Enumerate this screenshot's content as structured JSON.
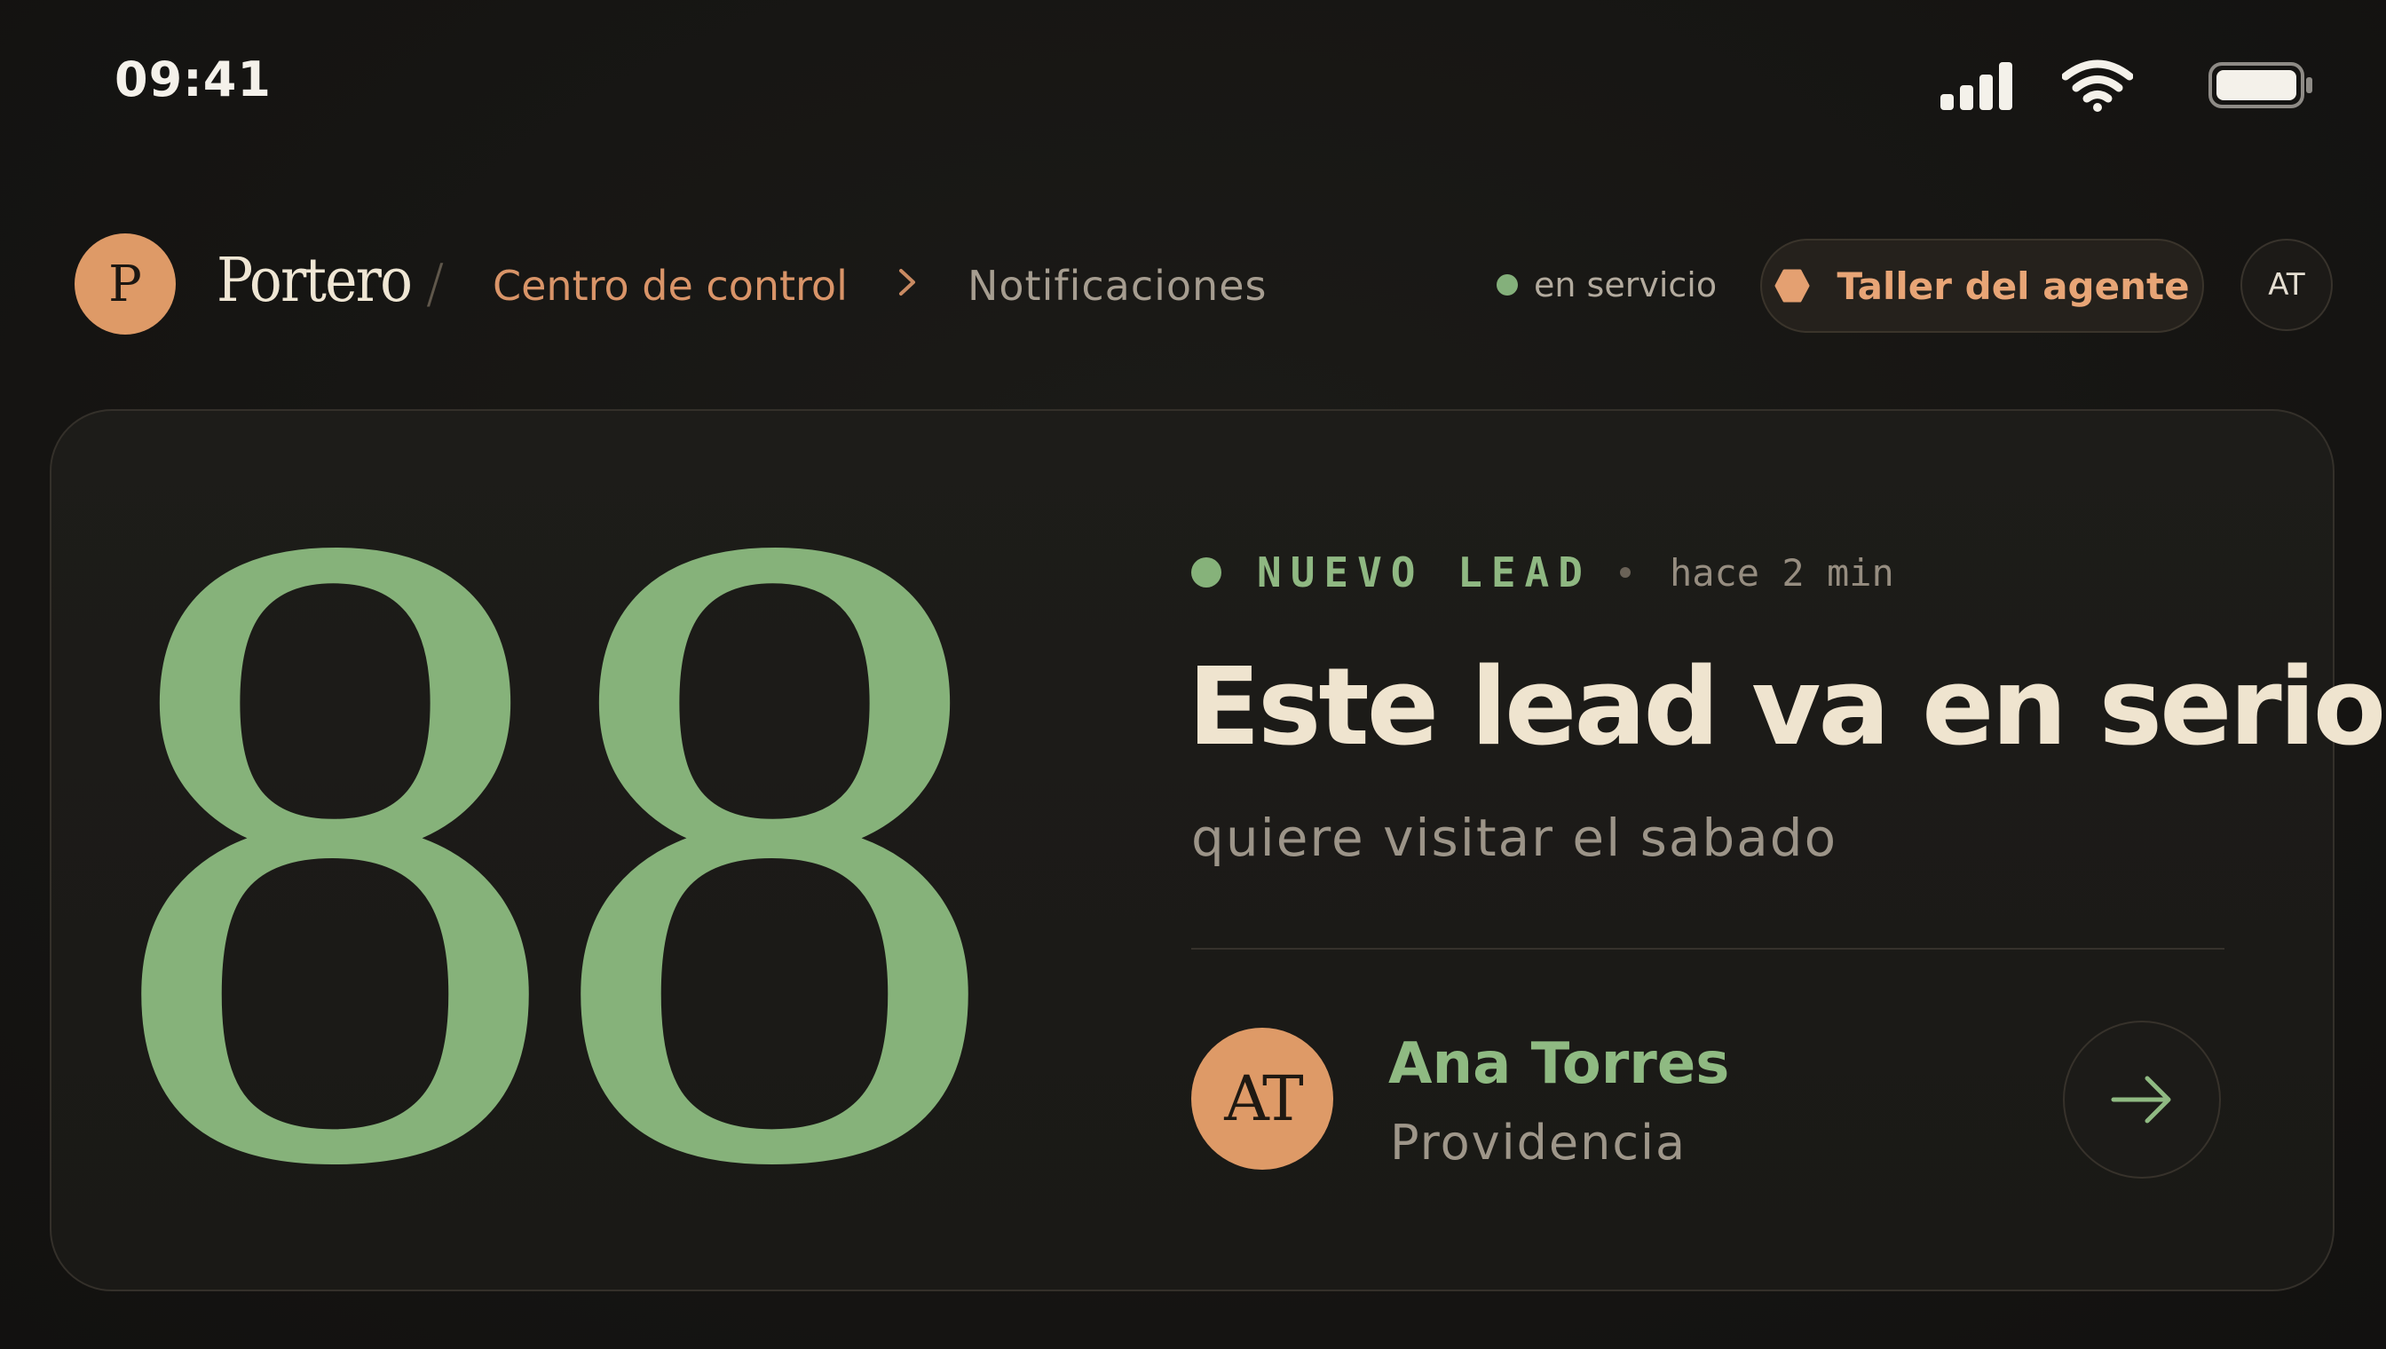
{
  "status_bar": {
    "time": "09:41",
    "icons": [
      "signal-icon",
      "wifi-icon",
      "battery-icon"
    ]
  },
  "header": {
    "logo_letter": "P",
    "brand": "Portero",
    "separator": "/",
    "breadcrumb": {
      "control": "Centro de control",
      "current": "Notificaciones"
    },
    "service_status": "en servicio",
    "workshop_button": "Taller del agente",
    "user_initials": "AT"
  },
  "lead": {
    "score": "88",
    "tag": "NUEVO LEAD",
    "time_ago": "hace 2 min",
    "title": "Este lead va en serio",
    "subtitle": "quiere visitar el sabado",
    "contact": {
      "initials": "AT",
      "name": "Ana Torres",
      "location": "Providencia"
    }
  },
  "colors": {
    "background": "#161513",
    "accent_orange": "#de9a67",
    "accent_green": "#86b27a",
    "text_primary": "#efe4cf",
    "text_muted": "#9c9488"
  }
}
